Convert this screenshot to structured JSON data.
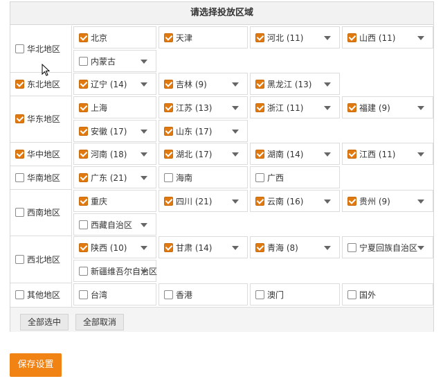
{
  "title": "请选择投放区域",
  "regions": [
    {
      "label": "华北地区",
      "checked": false,
      "provinces": [
        {
          "label": "北京",
          "checked": true,
          "caret": false
        },
        {
          "label": "天津",
          "checked": true,
          "caret": false
        },
        {
          "label": "河北 (11)",
          "checked": true,
          "caret": true
        },
        {
          "label": "山西 (11)",
          "checked": true,
          "caret": true
        },
        {
          "label": "内蒙古",
          "checked": false,
          "caret": true
        }
      ]
    },
    {
      "label": "东北地区",
      "checked": true,
      "provinces": [
        {
          "label": "辽宁 (14)",
          "checked": true,
          "caret": true
        },
        {
          "label": "吉林 (9)",
          "checked": true,
          "caret": true
        },
        {
          "label": "黑龙江 (13)",
          "checked": true,
          "caret": true
        }
      ]
    },
    {
      "label": "华东地区",
      "checked": true,
      "provinces": [
        {
          "label": "上海",
          "checked": true,
          "caret": false
        },
        {
          "label": "江苏 (13)",
          "checked": true,
          "caret": true
        },
        {
          "label": "浙江 (11)",
          "checked": true,
          "caret": true
        },
        {
          "label": "福建 (9)",
          "checked": true,
          "caret": true
        },
        {
          "label": "安徽 (17)",
          "checked": true,
          "caret": true
        },
        {
          "label": "山东 (17)",
          "checked": true,
          "caret": true
        }
      ]
    },
    {
      "label": "华中地区",
      "checked": true,
      "provinces": [
        {
          "label": "河南 (18)",
          "checked": true,
          "caret": true
        },
        {
          "label": "湖北 (17)",
          "checked": true,
          "caret": true
        },
        {
          "label": "湖南 (14)",
          "checked": true,
          "caret": true
        },
        {
          "label": "江西 (11)",
          "checked": true,
          "caret": true
        }
      ]
    },
    {
      "label": "华南地区",
      "checked": false,
      "provinces": [
        {
          "label": "广东 (21)",
          "checked": true,
          "caret": true
        },
        {
          "label": "海南",
          "checked": false,
          "caret": false
        },
        {
          "label": "广西",
          "checked": false,
          "caret": false
        }
      ]
    },
    {
      "label": "西南地区",
      "checked": false,
      "provinces": [
        {
          "label": "重庆",
          "checked": true,
          "caret": false
        },
        {
          "label": "四川 (21)",
          "checked": true,
          "caret": true
        },
        {
          "label": "云南 (16)",
          "checked": true,
          "caret": true
        },
        {
          "label": "贵州 (9)",
          "checked": true,
          "caret": true
        },
        {
          "label": "西藏自治区",
          "checked": false,
          "caret": true
        }
      ]
    },
    {
      "label": "西北地区",
      "checked": false,
      "provinces": [
        {
          "label": "陕西 (10)",
          "checked": true,
          "caret": true
        },
        {
          "label": "甘肃 (14)",
          "checked": true,
          "caret": true
        },
        {
          "label": "青海 (8)",
          "checked": true,
          "caret": true
        },
        {
          "label": "宁夏回族自治区",
          "checked": false,
          "caret": true
        },
        {
          "label": "新疆维吾尔自治区",
          "checked": false,
          "caret": true
        }
      ]
    },
    {
      "label": "其他地区",
      "checked": false,
      "provinces": [
        {
          "label": "台湾",
          "checked": false,
          "caret": false
        },
        {
          "label": "香港",
          "checked": false,
          "caret": false
        },
        {
          "label": "澳门",
          "checked": false,
          "caret": false
        },
        {
          "label": "国外",
          "checked": false,
          "caret": false
        }
      ]
    }
  ],
  "footer": {
    "select_all": "全部选中",
    "deselect_all": "全部取消"
  },
  "save_label": "保存设置",
  "colors": {
    "accent": "#e07a10",
    "save_bg": "#f08313"
  }
}
